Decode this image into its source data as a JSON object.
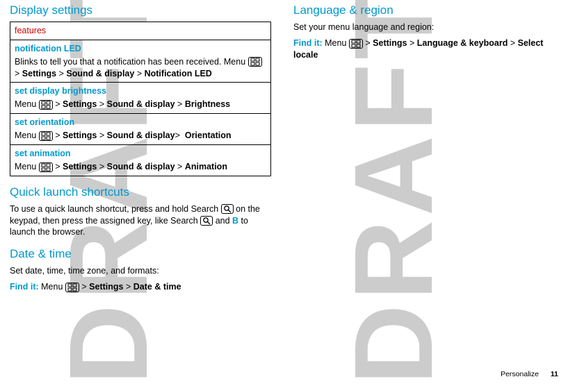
{
  "watermark": "DRAFT",
  "left": {
    "section_display": "Display settings",
    "table_header": "features",
    "rows": [
      {
        "title": "notification LED",
        "pre": "Blinks to tell you that a notification has been received. Menu ",
        "path1": "Settings",
        "path2": "Sound & display",
        "path3": "Notification LED"
      },
      {
        "title": "set display brightness",
        "pre": "Menu ",
        "path1": "Settings",
        "path2": "Sound & display",
        "path3": "Brightness"
      },
      {
        "title": "set orientation",
        "pre": "Menu ",
        "path1": "Settings",
        "path2": "Sound & display",
        "path3": "Orientation",
        "nospace2": true
      },
      {
        "title": "set animation",
        "pre": "Menu ",
        "path1": "Settings",
        "path2": "Sound & display",
        "path3": "Animation"
      }
    ],
    "section_shortcuts": "Quick launch shortcuts",
    "shortcuts_pre": "To use a quick launch shortcut, press and hold Search ",
    "shortcuts_mid": " on the keypad, then press the assigned key, like Search ",
    "shortcuts_and": " and ",
    "shortcuts_b": "B",
    "shortcuts_post": " to launch the browser.",
    "section_datetime": "Date & time",
    "datetime_text": "Set date, time, time zone, and formats:",
    "datetime_find": "Find it:",
    "datetime_menu": " Menu ",
    "datetime_p1": "Settings",
    "datetime_p2": "Date & time"
  },
  "right": {
    "section_lang": "Language & region",
    "lang_text": "Set your menu language and region:",
    "lang_find": "Find it:",
    "lang_menu": " Menu ",
    "lang_p1": "Settings",
    "lang_p2": "Language & keyboard",
    "lang_p3": "Select locale"
  },
  "footer": {
    "section": "Personalize",
    "page": "11"
  },
  "glyphs": {
    "gt": ">"
  }
}
